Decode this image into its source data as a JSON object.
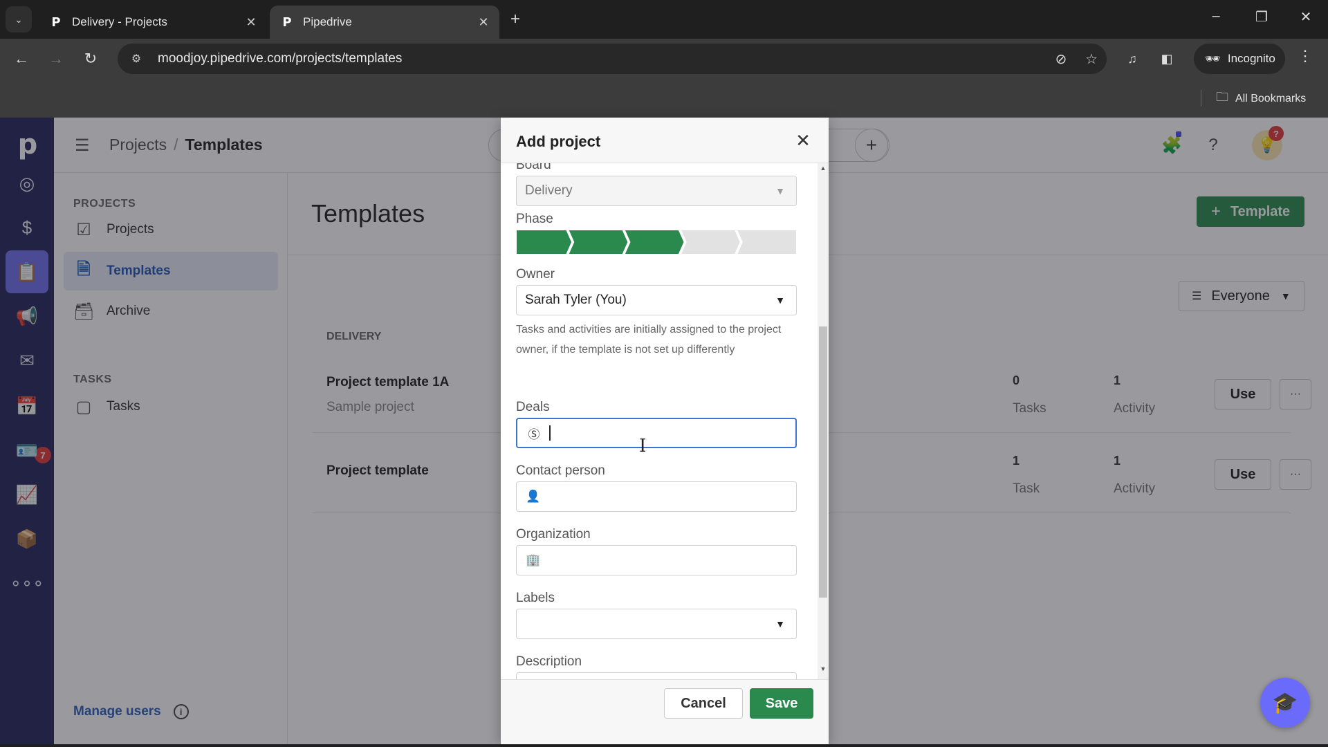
{
  "browser": {
    "tabs": [
      {
        "title": "Delivery - Projects",
        "favicon": "P",
        "active": false
      },
      {
        "title": "Pipedrive",
        "favicon": "P",
        "active": true
      }
    ],
    "url": "moodjoy.pipedrive.com/projects/templates",
    "incognito_label": "Incognito",
    "all_bookmarks": "All Bookmarks"
  },
  "app": {
    "logo": "p",
    "rail_badge_count": "7",
    "breadcrumb": {
      "parent": "Projects",
      "separator": "/",
      "current": "Templates"
    },
    "bulb_badge": "?",
    "subnav": {
      "sections": [
        {
          "heading": "PROJECTS",
          "items": [
            {
              "label": "Projects",
              "active": false
            },
            {
              "label": "Templates",
              "active": true
            },
            {
              "label": "Archive",
              "active": false
            }
          ]
        },
        {
          "heading": "TASKS",
          "items": [
            {
              "label": "Tasks",
              "active": false
            }
          ]
        }
      ],
      "manage_users": "Manage users"
    },
    "main": {
      "title": "Templates",
      "add_button": "Template",
      "filter_label": "Everyone",
      "group": "DELIVERY",
      "templates": [
        {
          "name": "Project template 1A",
          "description": "Sample project",
          "tasks": "0",
          "tasks_label": "Tasks",
          "activities": "1",
          "activities_label": "Activity",
          "use_label": "Use",
          "more": "···"
        },
        {
          "name": "Project template",
          "description": "",
          "tasks": "1",
          "tasks_label": "Task",
          "activities": "1",
          "activities_label": "Activity",
          "use_label": "Use",
          "more": "···"
        }
      ]
    }
  },
  "modal": {
    "title": "Add project",
    "fields": {
      "board": {
        "label": "Board",
        "value": "Delivery"
      },
      "phase": {
        "label": "Phase",
        "total_phases": 5,
        "completed_phases": 3
      },
      "owner": {
        "label": "Owner",
        "value": "Sarah Tyler (You)",
        "hint": "Tasks and activities are initially assigned to the project owner, if the template is not set up differently"
      },
      "deals": {
        "label": "Deals",
        "value": ""
      },
      "contact": {
        "label": "Contact person",
        "value": ""
      },
      "organization": {
        "label": "Organization",
        "value": ""
      },
      "labels": {
        "label": "Labels",
        "value": ""
      },
      "description": {
        "label": "Description",
        "value": ""
      }
    },
    "cancel_label": "Cancel",
    "save_label": "Save"
  },
  "colors": {
    "brand_green": "#2a8a4e",
    "phase_done": "#2a8a4e",
    "phase_todo": "#e2e2e2",
    "rail_bg": "#26265d",
    "rail_active": "#6f6fef",
    "focus_blue": "#3b74d4"
  }
}
